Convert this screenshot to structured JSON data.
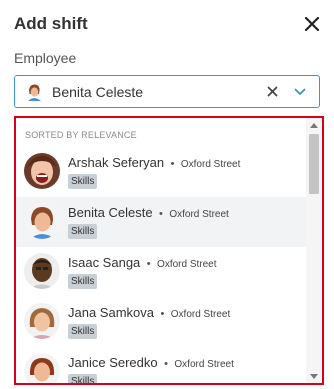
{
  "dialog": {
    "title": "Add shift",
    "close_icon": "close-icon"
  },
  "employee_field": {
    "label": "Employee",
    "value": "Benita Celeste",
    "clear_icon": "clear-x-icon",
    "chevron_icon": "chevron-down-icon",
    "accent_color": "#3f95c8"
  },
  "dropdown": {
    "group_heading": "SORTED BY RELEVANCE",
    "highlight_border_color": "#d9001b",
    "items": [
      {
        "name": "Arshak Seferyan",
        "separator": "•",
        "location": "Oxford Street",
        "badge": "Skills"
      },
      {
        "name": "Benita Celeste",
        "separator": "•",
        "location": "Oxford Street",
        "badge": "Skills"
      },
      {
        "name": "Isaac Sanga",
        "separator": "•",
        "location": "Oxford Street",
        "badge": "Skills"
      },
      {
        "name": "Jana Samkova",
        "separator": "•",
        "location": "Oxford Street",
        "badge": "Skills"
      },
      {
        "name": "Janice Seredko",
        "separator": "•",
        "location": "Oxford Street",
        "badge": "Skills"
      }
    ]
  }
}
